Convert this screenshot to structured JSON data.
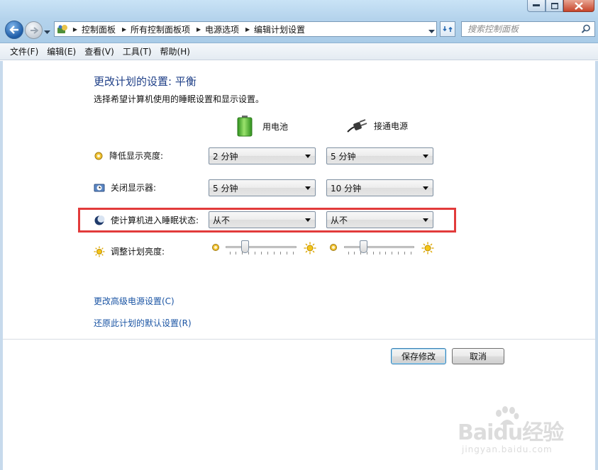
{
  "breadcrumb": {
    "items": [
      "控制面板",
      "所有控制面板项",
      "电源选项",
      "编辑计划设置"
    ]
  },
  "search": {
    "placeholder": "搜索控制面板"
  },
  "menu": {
    "file": "文件(F)",
    "edit": "编辑(E)",
    "view": "查看(V)",
    "tools": "工具(T)",
    "help": "帮助(H)"
  },
  "page": {
    "title": "更改计划的设置: 平衡",
    "subtitle": "选择希望计算机使用的睡眠设置和显示设置。"
  },
  "columns": {
    "battery": "用电池",
    "plugged": "接通电源"
  },
  "settings": {
    "dim_display": {
      "label": "降低显示亮度:",
      "battery": "2 分钟",
      "plugged": "5 分钟"
    },
    "turn_off_display": {
      "label": "关闭显示器:",
      "battery": "5 分钟",
      "plugged": "10 分钟"
    },
    "sleep": {
      "label": "使计算机进入睡眠状态:",
      "battery": "从不",
      "plugged": "从不"
    },
    "brightness": {
      "label": "调整计划亮度:",
      "battery_level": 0.25,
      "plugged_level": 0.25
    }
  },
  "links": {
    "advanced": "更改高级电源设置(C)",
    "restore": "还原此计划的默认设置(R)"
  },
  "buttons": {
    "save": "保存修改",
    "cancel": "取消"
  },
  "watermark": {
    "main": "Baidu经验",
    "sub": "jingyan.baidu.com"
  },
  "colors": {
    "heading": "#1e3f87",
    "link": "#1b55a4",
    "highlight_box": "#e23b3b"
  }
}
